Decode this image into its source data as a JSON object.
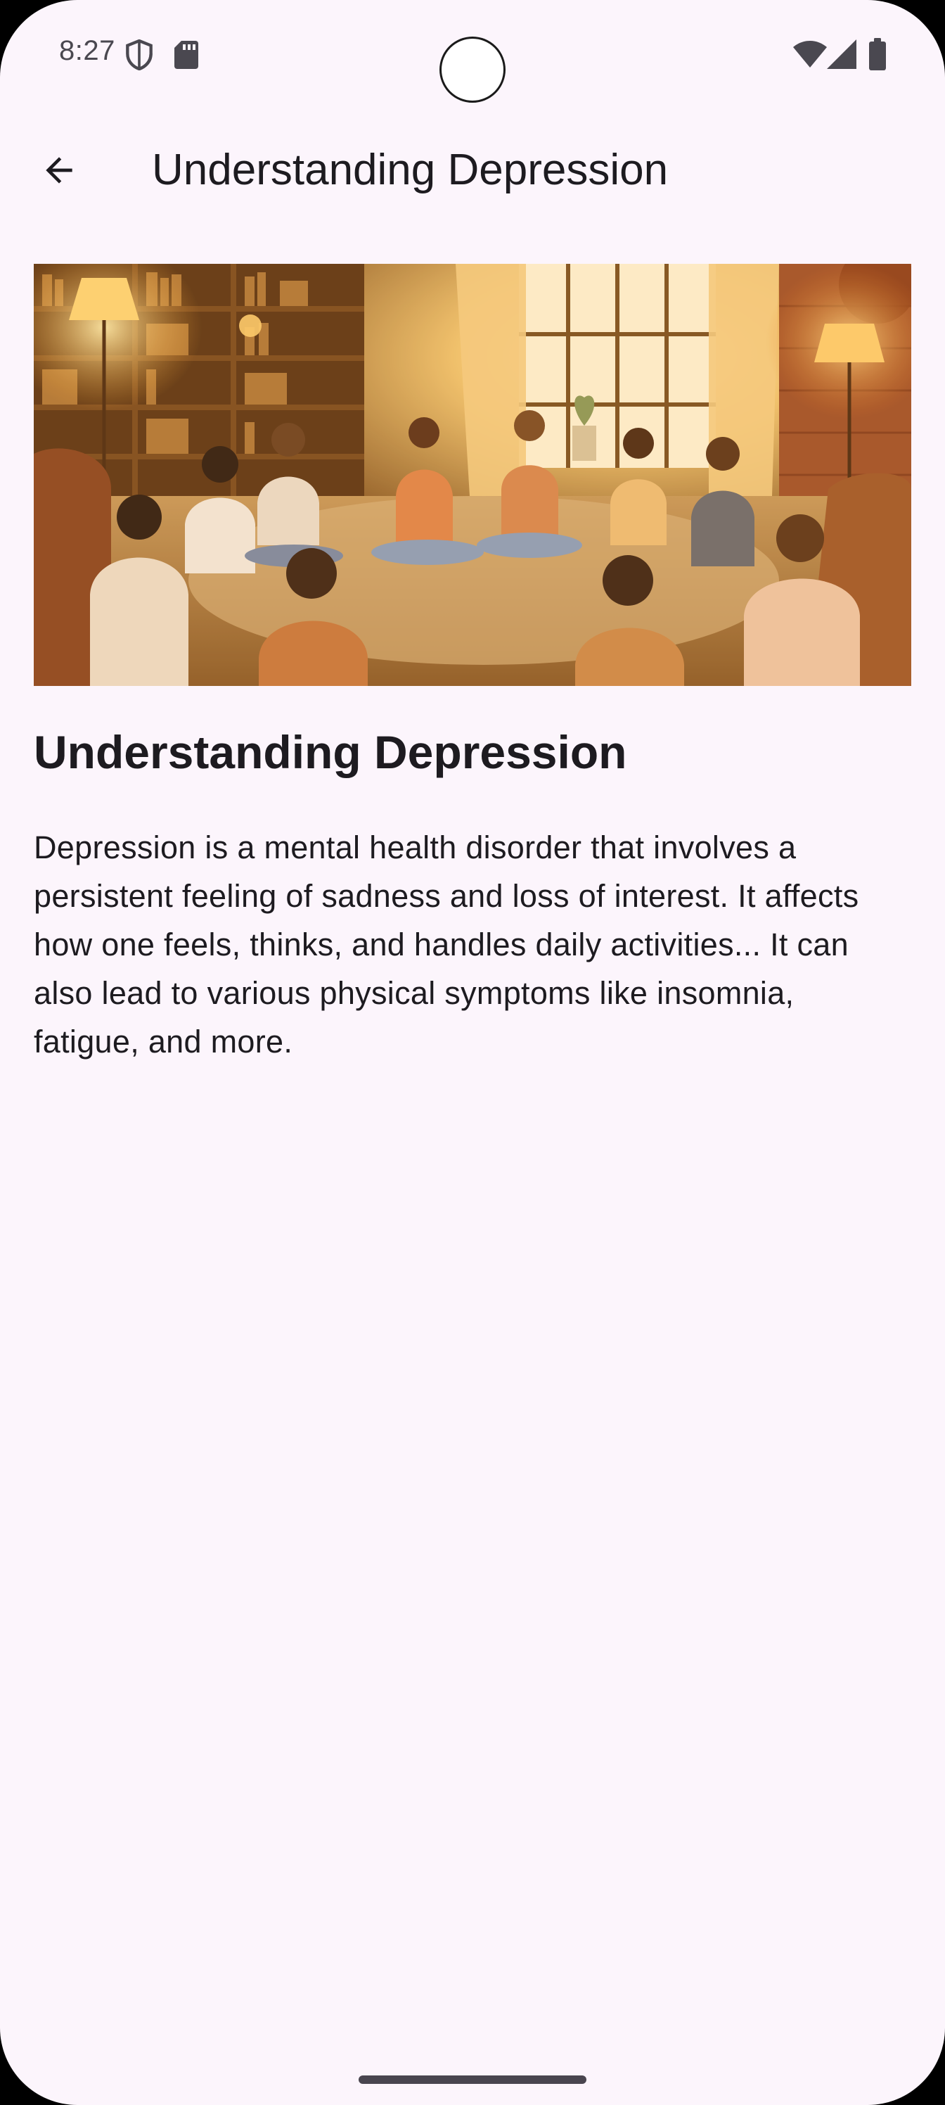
{
  "status_bar": {
    "time": "8:27",
    "left_icons": [
      "shield-icon",
      "sd-card-icon"
    ],
    "right_icons": [
      "wifi-icon",
      "cellular-signal-icon",
      "battery-icon"
    ]
  },
  "app_bar": {
    "back_icon": "arrow-back-icon",
    "title": "Understanding Depression"
  },
  "article": {
    "image_icon": "support-group-illustration",
    "heading": "Understanding Depression",
    "body": "Depression is a mental health disorder that involves a persistent feeling of sadness and loss of interest. It affects how one feels, thinks, and handles daily activities... It can also lead to various physical symptoms like insomnia, fatigue, and more."
  },
  "colors": {
    "background": "#fcf5fc",
    "text_primary": "#1d1b20",
    "status_text": "#4a4850",
    "image_warm": "#e8a54b"
  }
}
